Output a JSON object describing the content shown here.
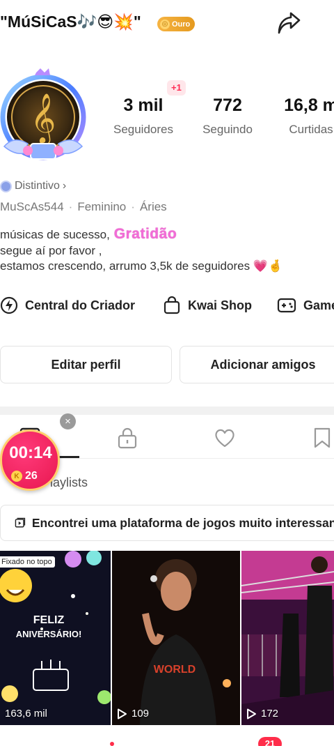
{
  "header": {
    "profile_name": "\"MúSiCaS🎶😎💥\"",
    "level_badge": "Ouro",
    "share_icon": "share-arrow-icon"
  },
  "stats": {
    "followers_delta": "+1",
    "followers": {
      "value": "3 mil",
      "label": "Seguidores"
    },
    "following": {
      "value": "772",
      "label": "Seguindo"
    },
    "likes": {
      "value": "16,8 m",
      "label": "Curtidas"
    }
  },
  "profile": {
    "badge_link": "Distintivo",
    "username": "MuScAs544",
    "gender": "Feminino",
    "sign": "Áries",
    "bio_line1": "músicas de sucesso,",
    "bio_gratitude": "Gratidão",
    "bio_line2": "segue aí por favor ,",
    "bio_line3": "estamos crescendo, arrumo 3,5k de seguidores 💗🤞"
  },
  "quick_links": {
    "creator": "Central do Criador",
    "shop": "Kwai Shop",
    "games": "Games"
  },
  "buttons": {
    "edit_profile": "Editar perfil",
    "add_friends": "Adicionar amigos"
  },
  "tabs": {
    "playlists_label": "Playlists",
    "icons": [
      "videos-grid-icon",
      "lock-icon",
      "heart-icon",
      "bookmark-icon"
    ]
  },
  "timer": {
    "time": "00:14",
    "coins": "26",
    "close": "×"
  },
  "promo": {
    "text": "Encontrei uma plataforma de jogos muito interessante"
  },
  "videos": [
    {
      "views": "163,6 mil",
      "pinned": "Fixado no topo",
      "caption": "FELIZ ANIVERSÁRIO!"
    },
    {
      "views": "109"
    },
    {
      "views": "172"
    }
  ],
  "nav": {
    "notification_count": "21"
  },
  "colors": {
    "accent": "#ff2d55",
    "gratitude_pink": "#f26cd6",
    "badge_gold": "#e59a1f"
  }
}
